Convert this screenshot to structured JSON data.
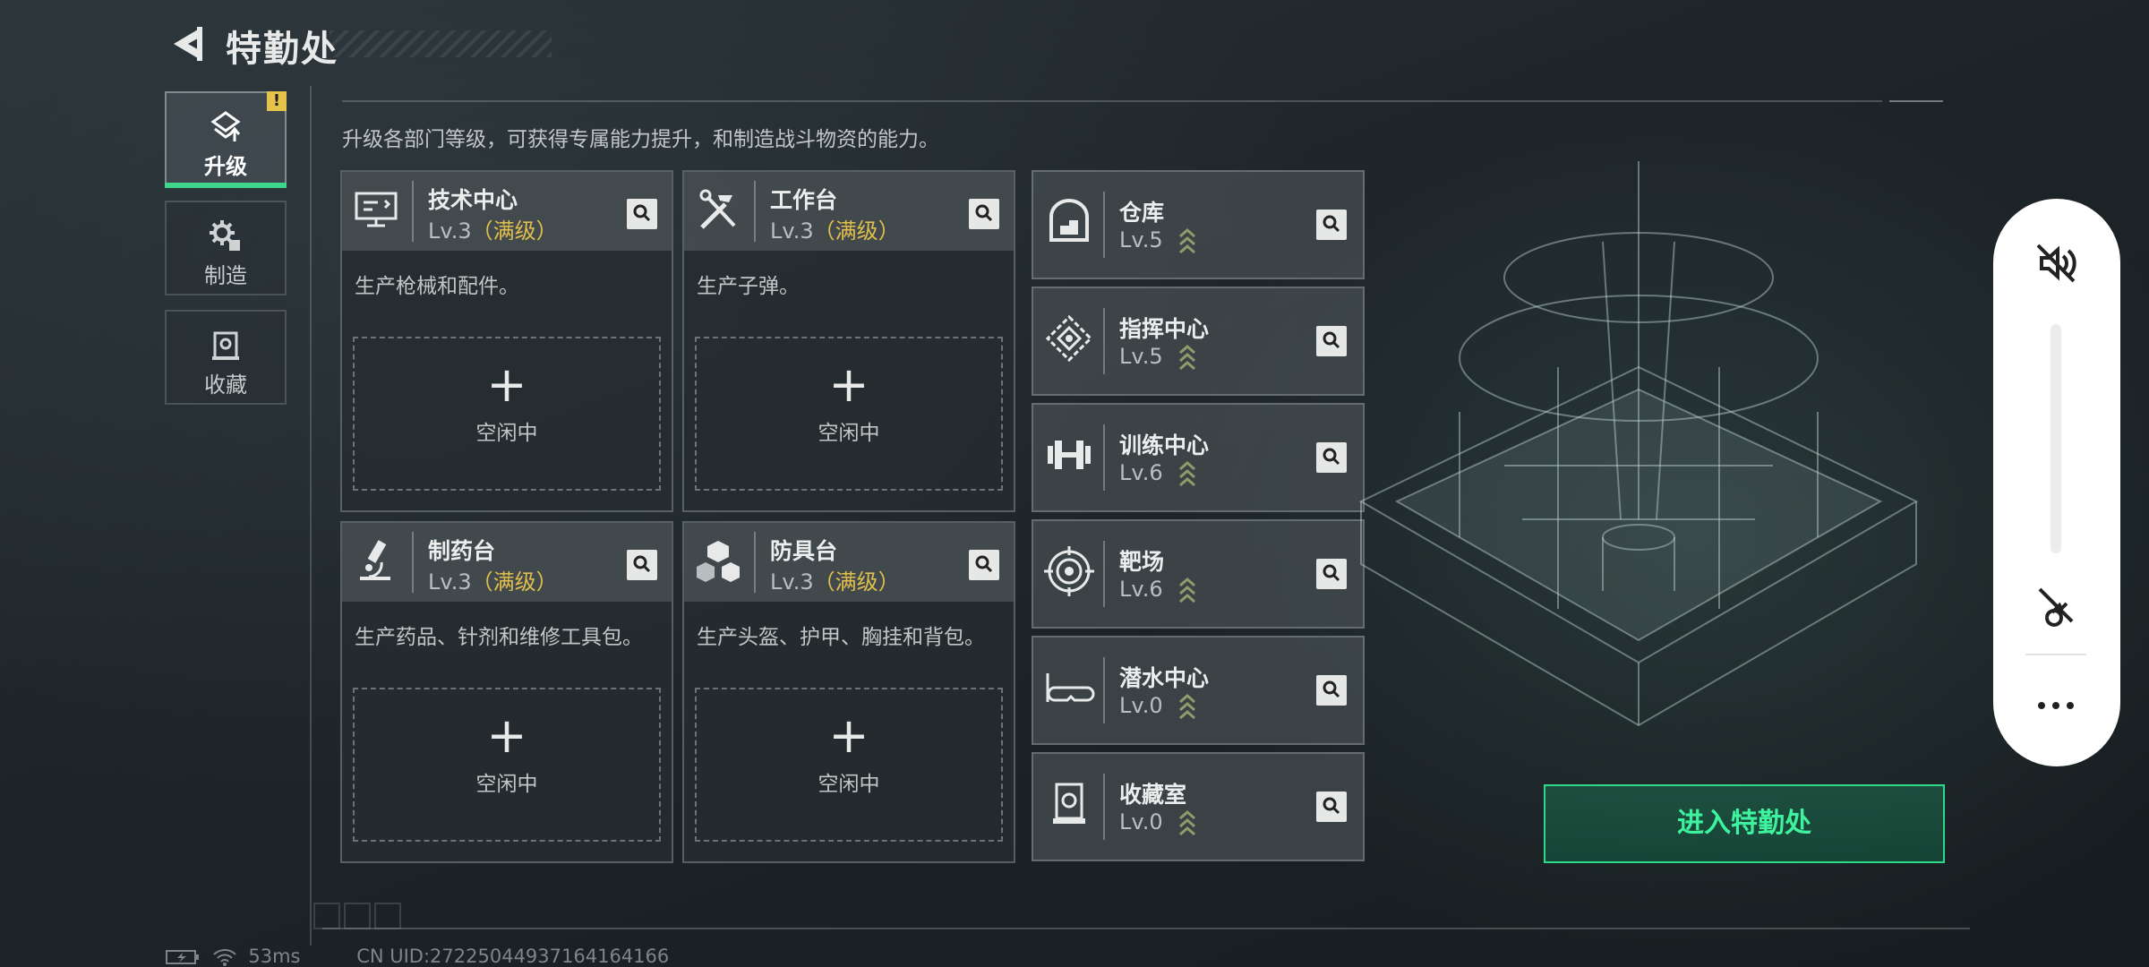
{
  "header": {
    "title": "特勤处"
  },
  "side_tabs": [
    {
      "label": "升级",
      "icon": "upgrade-icon",
      "active": true,
      "alert": "!"
    },
    {
      "label": "制造",
      "icon": "gear-icon",
      "active": false
    },
    {
      "label": "收藏",
      "icon": "collection-icon",
      "active": false
    }
  ],
  "description": "升级各部门等级，可获得专属能力提升，和制造战斗物资的能力。",
  "production_cards": [
    {
      "name": "技术中心",
      "level": "Lv.3",
      "level_tag": "（满级）",
      "desc": "生产枪械和配件。",
      "slot_plus": "+",
      "slot_label": "空闲中",
      "icon": "monitor-icon"
    },
    {
      "name": "工作台",
      "level": "Lv.3",
      "level_tag": "（满级）",
      "desc": "生产子弹。",
      "slot_plus": "+",
      "slot_label": "空闲中",
      "icon": "tools-icon"
    },
    {
      "name": "制药台",
      "level": "Lv.3",
      "level_tag": "（满级）",
      "desc": "生产药品、针剂和维修工具包。",
      "slot_plus": "+",
      "slot_label": "空闲中",
      "icon": "microscope-icon"
    },
    {
      "name": "防具台",
      "level": "Lv.3",
      "level_tag": "（满级）",
      "desc": "生产头盔、护甲、胸挂和背包。",
      "slot_plus": "+",
      "slot_label": "空闲中",
      "icon": "armor-icon"
    }
  ],
  "facility_cards": [
    {
      "name": "仓库",
      "level": "Lv.5",
      "icon": "warehouse-icon"
    },
    {
      "name": "指挥中心",
      "level": "Lv.5",
      "icon": "command-icon"
    },
    {
      "name": "训练中心",
      "level": "Lv.6",
      "icon": "dumbbell-icon"
    },
    {
      "name": "靶场",
      "level": "Lv.6",
      "icon": "target-icon"
    },
    {
      "name": "潜水中心",
      "level": "Lv.0",
      "icon": "diving-mask-icon"
    },
    {
      "name": "收藏室",
      "level": "Lv.0",
      "icon": "collection-icon"
    }
  ],
  "enter_button": "进入特勤处",
  "status_bar": {
    "latency": "53ms",
    "uid": "CN UID:27225044937164164166"
  },
  "overlay_panel": {
    "more": "···"
  },
  "colors": {
    "accent_green": "#3ff29e",
    "maxed_gold": "#e0bf4c",
    "alert_yellow": "#e6c34a"
  }
}
